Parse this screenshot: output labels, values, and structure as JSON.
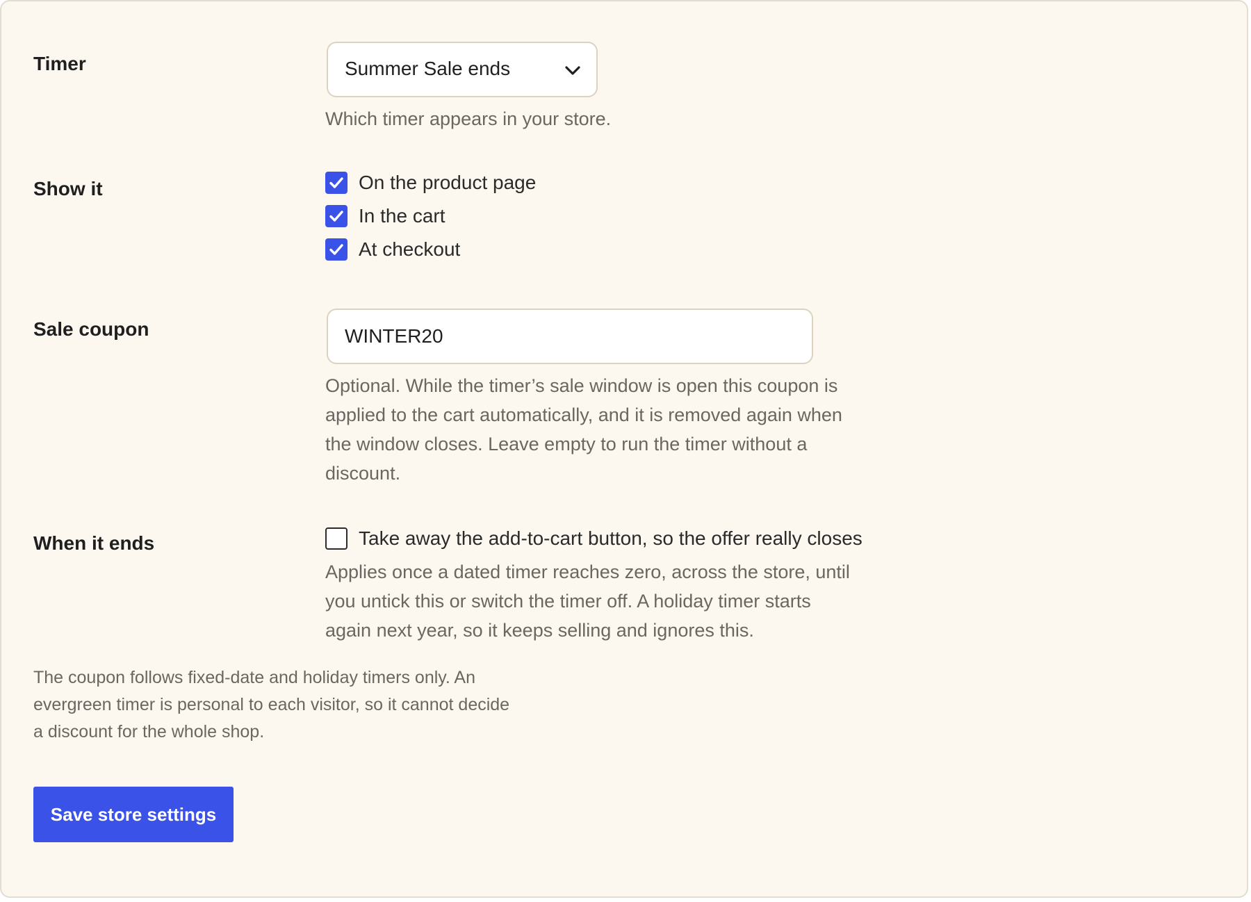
{
  "timer": {
    "label": "Timer",
    "selected": "Summer Sale ends",
    "help": "Which timer appears in your store."
  },
  "show_it": {
    "label": "Show it",
    "options": [
      {
        "label": "On the product page",
        "checked": true
      },
      {
        "label": "In the cart",
        "checked": true
      },
      {
        "label": "At checkout",
        "checked": true
      }
    ]
  },
  "sale_coupon": {
    "label": "Sale coupon",
    "value": "WINTER20",
    "help_lines": [
      "Optional. While the timer’s sale window is open this coupon is",
      "applied to the cart automatically, and it is removed again when",
      "the window closes. Leave empty to run the timer without a",
      "discount."
    ]
  },
  "when_it_ends": {
    "label": "When it ends",
    "option": {
      "label": "Take away the add-to-cart button, so the offer really closes",
      "checked": false
    },
    "help_lines": [
      "Applies once a dated timer reaches zero, across the store, until",
      "you untick this or switch the timer off. A holiday timer starts",
      "again next year, so it keeps selling and ignores this."
    ]
  },
  "note_lines": [
    "The coupon follows fixed-date and holiday timers only. An",
    "evergreen timer is personal to each visitor, so it cannot decide",
    "a discount for the whole shop."
  ],
  "save_label": "Save store settings",
  "colors": {
    "accent": "#3a52e8",
    "background": "#fcf8f0",
    "help_text": "#6b6660"
  },
  "icons": {
    "select_chevron": "chevron-down-icon",
    "checkbox_check": "checkmark-icon"
  }
}
